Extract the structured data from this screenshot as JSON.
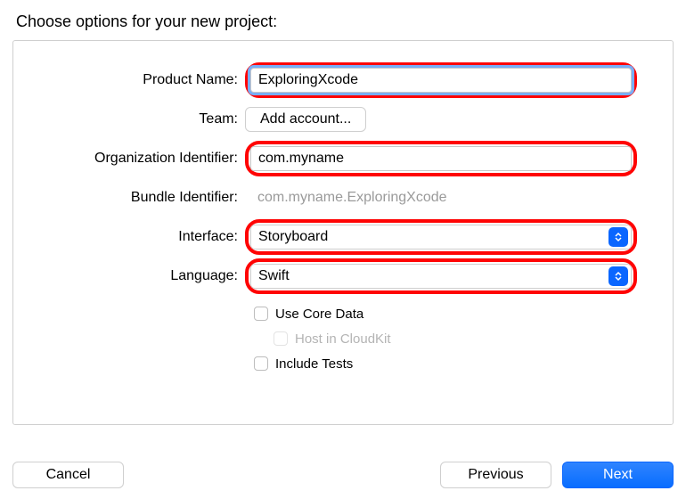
{
  "title": "Choose options for your new project:",
  "labels": {
    "product_name": "Product Name:",
    "team": "Team:",
    "org_identifier": "Organization Identifier:",
    "bundle_identifier": "Bundle Identifier:",
    "interface": "Interface:",
    "language": "Language:"
  },
  "values": {
    "product_name": "ExploringXcode",
    "team_button": "Add account...",
    "org_identifier": "com.myname",
    "bundle_identifier": "com.myname.ExploringXcode",
    "interface": "Storyboard",
    "language": "Swift"
  },
  "checks": {
    "core_data": "Use Core Data",
    "cloudkit": "Host in CloudKit",
    "include_tests": "Include Tests"
  },
  "buttons": {
    "cancel": "Cancel",
    "previous": "Previous",
    "next": "Next"
  }
}
